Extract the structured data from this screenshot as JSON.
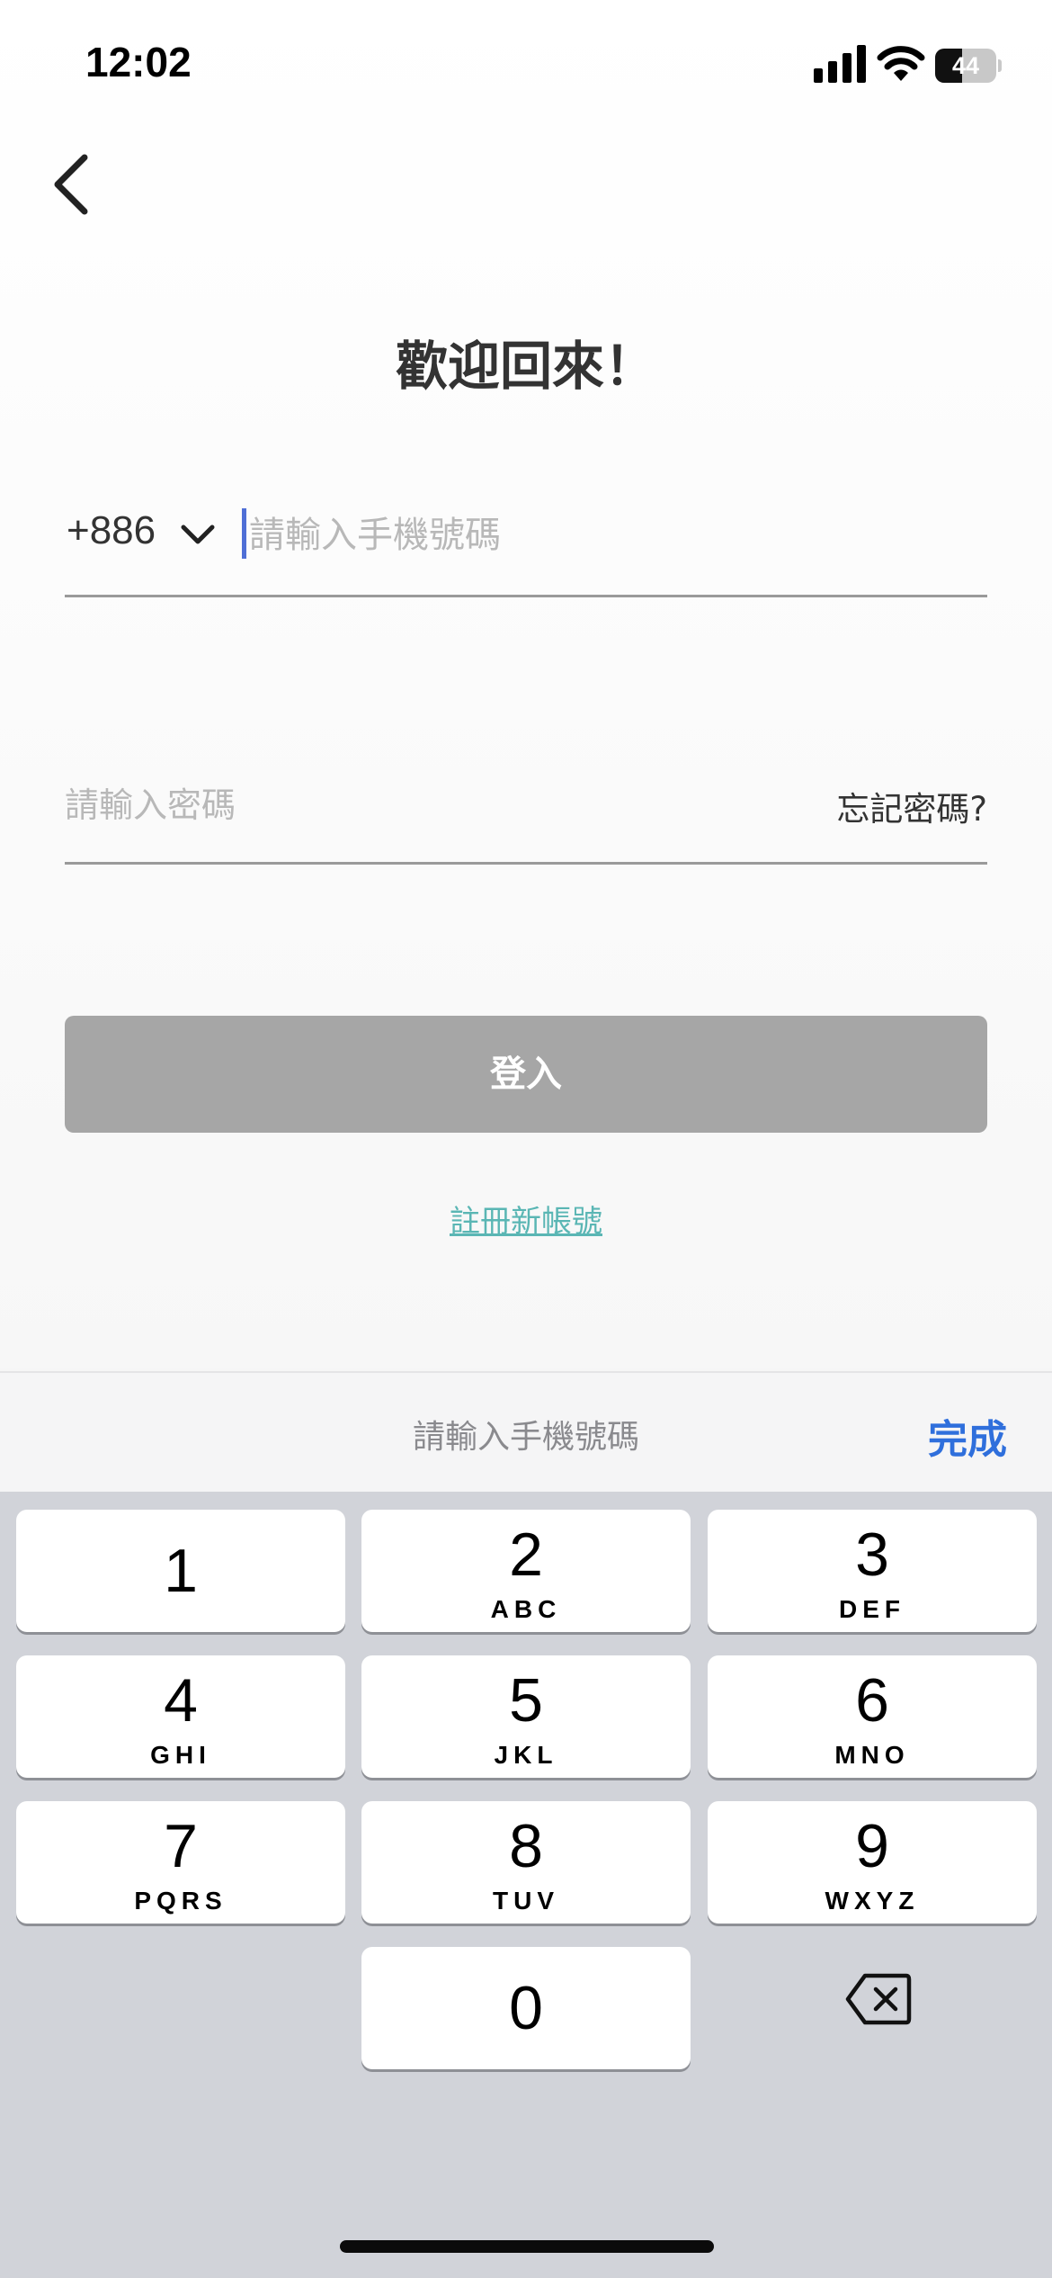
{
  "status_bar": {
    "time": "12:02",
    "battery_text": "44",
    "battery_level": 0.44
  },
  "screen": {
    "title": "歡迎回來！",
    "phone": {
      "country_code": "+886",
      "placeholder": "請輸入手機號碼",
      "value": ""
    },
    "password": {
      "placeholder": "請輸入密碼",
      "value": "",
      "forgot_label": "忘記密碼?"
    },
    "login_label": "登入",
    "register_label": "註冊新帳號"
  },
  "keyboard": {
    "accessory_placeholder": "請輸入手機號碼",
    "done_label": "完成",
    "keys": [
      {
        "digit": "1",
        "letters": ""
      },
      {
        "digit": "2",
        "letters": "ABC"
      },
      {
        "digit": "3",
        "letters": "DEF"
      },
      {
        "digit": "4",
        "letters": "GHI"
      },
      {
        "digit": "5",
        "letters": "JKL"
      },
      {
        "digit": "6",
        "letters": "MNO"
      },
      {
        "digit": "7",
        "letters": "PQRS"
      },
      {
        "digit": "8",
        "letters": "TUV"
      },
      {
        "digit": "9",
        "letters": "WXYZ"
      },
      {
        "digit": "0",
        "letters": ""
      }
    ]
  },
  "colors": {
    "accent_blue": "#2f6fdc",
    "register_link": "#5ab6b4",
    "login_disabled": "#a6a6a6",
    "keyboard_bg": "#d1d3d9"
  },
  "icons": [
    "signal-icon",
    "wifi-icon",
    "battery-icon",
    "back-chevron-icon",
    "chevron-down-icon",
    "backspace-icon"
  ]
}
